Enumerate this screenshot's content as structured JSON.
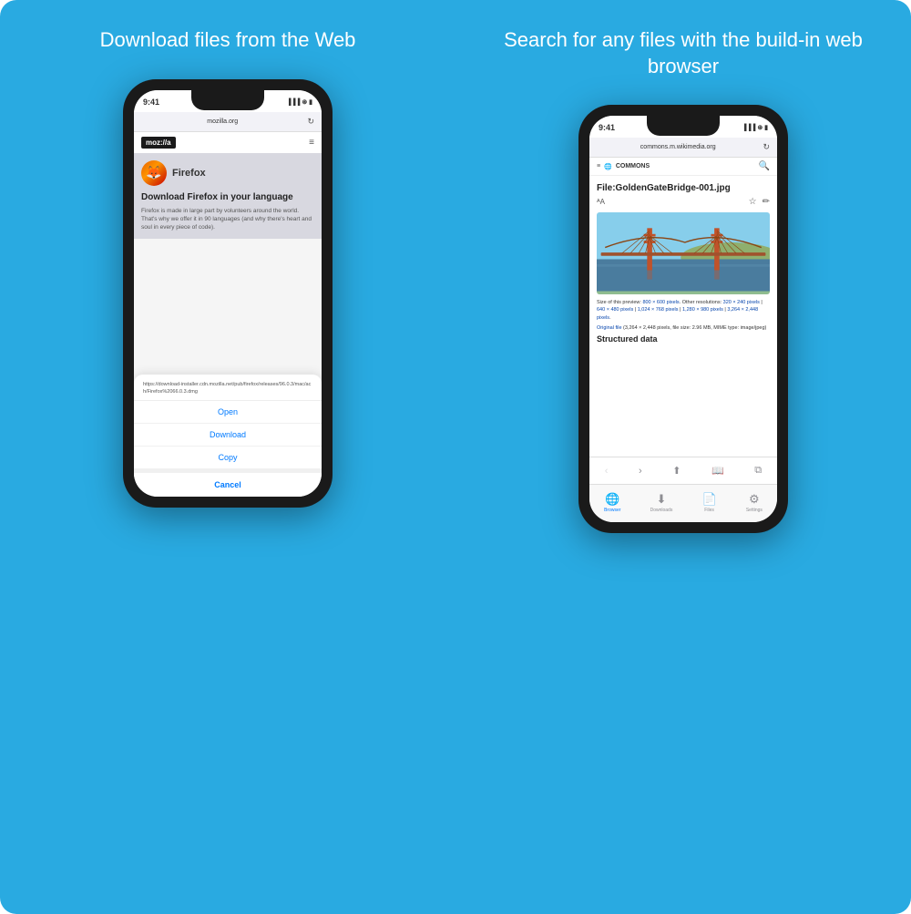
{
  "panels": {
    "left": {
      "title": "Download files from the Web",
      "bg_color": "#29aae1"
    },
    "right": {
      "title": "Search for any files with the build-in web browser",
      "bg_color": "#29aae1"
    }
  },
  "left_phone": {
    "status_time": "9:41",
    "status_icons": "▐▐▐ ⊛ ▮",
    "browser_url": "mozilla.org",
    "mozilla_logo": "moz://a",
    "firefox_name": "Firefox",
    "ff_headline": "Download Firefox\nin your language",
    "ff_body": "Firefox is made in large part by volunteers around the world. That's why we offer it in 90 languages (and why there's heart and soul in every piece of code).",
    "download_url": "https://download-installer.cdn.mozilla.net/pub/firefox/releases/96.0.3/mac/ach/Firefox%2066.0.3.dmg",
    "action_open": "Open",
    "action_download": "Download",
    "action_copy": "Copy",
    "action_cancel": "Cancel"
  },
  "right_phone": {
    "status_time": "9:41",
    "browser_url": "commons.m.wikimedia.org",
    "commons_label": "COMMONS",
    "wiki_title": "File:GoldenGateBridge-001.jpg",
    "wiki_desc": "Size of this preview: 800 × 600 pixels. Other resolutions: 320 × 240 pixels | 640 × 480 pixels | 1,024 × 768 pixels | 1,280 × 980 pixels | 3,264 × 2,448 pixels.",
    "wiki_original": "Original file (3,264 × 2,448 pixels, file size: 2.96 MB, MIME type: image/jpeg)",
    "wiki_structured": "Structured data",
    "nav_browser": "Browser",
    "nav_downloads": "Downloads",
    "nav_files": "Files",
    "nav_settings": "Settings"
  }
}
